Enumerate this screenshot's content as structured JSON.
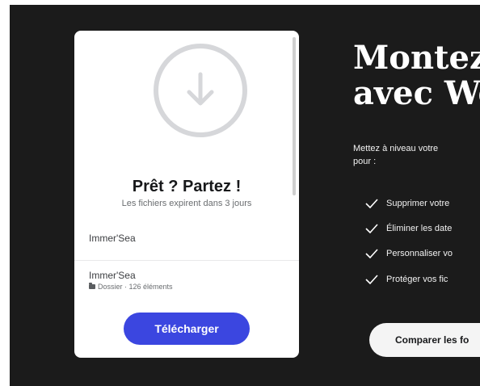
{
  "card": {
    "title": "Prêt ? Partez !",
    "expiry_note": "Les fichiers expirent dans 3 jours",
    "files": [
      {
        "name": "Immer'Sea"
      },
      {
        "name": "Immer'Sea",
        "meta": "Dossier · 126 éléments"
      }
    ],
    "download_label": "Télécharger"
  },
  "promo": {
    "heading_line1": "Montez",
    "heading_line2": "avec We",
    "intro_line1": "Mettez à niveau votre",
    "intro_line2": "pour :",
    "benefits": [
      "Supprimer votre",
      "Éliminer les date",
      "Personnaliser vo",
      "Protéger vos fic"
    ],
    "compare_label": "Comparer les fo"
  },
  "colors": {
    "background": "#1b1b1b",
    "card": "#ffffff",
    "accent": "#3b46e0",
    "ring": "#d6d7da"
  }
}
